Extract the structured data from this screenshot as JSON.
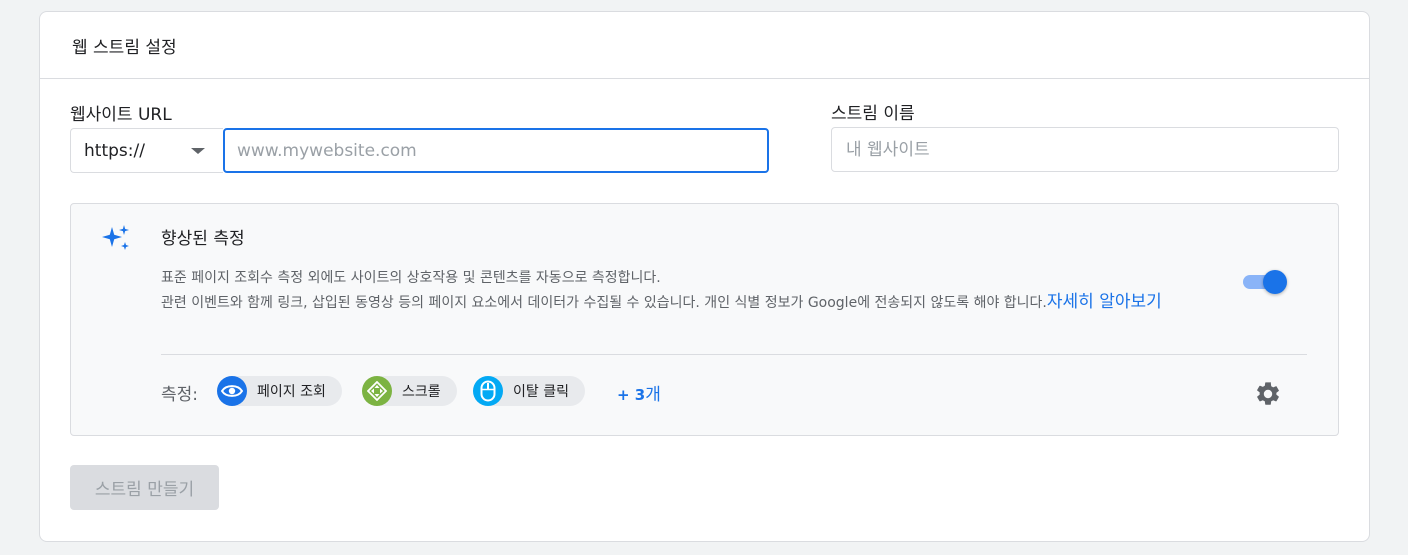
{
  "card": {
    "title": "웹 스트림 설정"
  },
  "url_field": {
    "label": "웹사이트 URL",
    "protocol": "https://",
    "placeholder": "www.mywebsite.com"
  },
  "name_field": {
    "label": "스트림 이름",
    "placeholder": "내 웹사이트"
  },
  "enhanced": {
    "icon": "sparkle-icon",
    "title": "향상된 측정",
    "desc_line1": "표준 페이지 조회수 측정 외에도 사이트의 상호작용 및 콘텐츠를 자동으로 측정합니다.",
    "desc_line2": "관련 이벤트와 함께 링크, 삽입된 동영상 등의 페이지 요소에서 데이터가 수집될 수 있습니다. 개인 식별 정보가 Google에 전송되지 않도록 해야 합니다.",
    "learn_more": "자세히 알아보기",
    "toggle_on": true,
    "measure_label": "측정:",
    "chips": [
      {
        "label": "페이지 조회",
        "icon": "eye-icon",
        "color": "#1a73e8"
      },
      {
        "label": "스크롤",
        "icon": "scroll-icon",
        "color": "#7cb342"
      },
      {
        "label": "이탈 클릭",
        "icon": "mouse-icon",
        "color": "#03a9f4"
      }
    ],
    "more_prefix": "+ ",
    "more_count": "3",
    "more_suffix": "개"
  },
  "create_button": "스트림 만들기",
  "colors": {
    "accent": "#1a73e8",
    "toggle_track": "#8ab4f8",
    "disabled_bg": "#dadce0"
  }
}
